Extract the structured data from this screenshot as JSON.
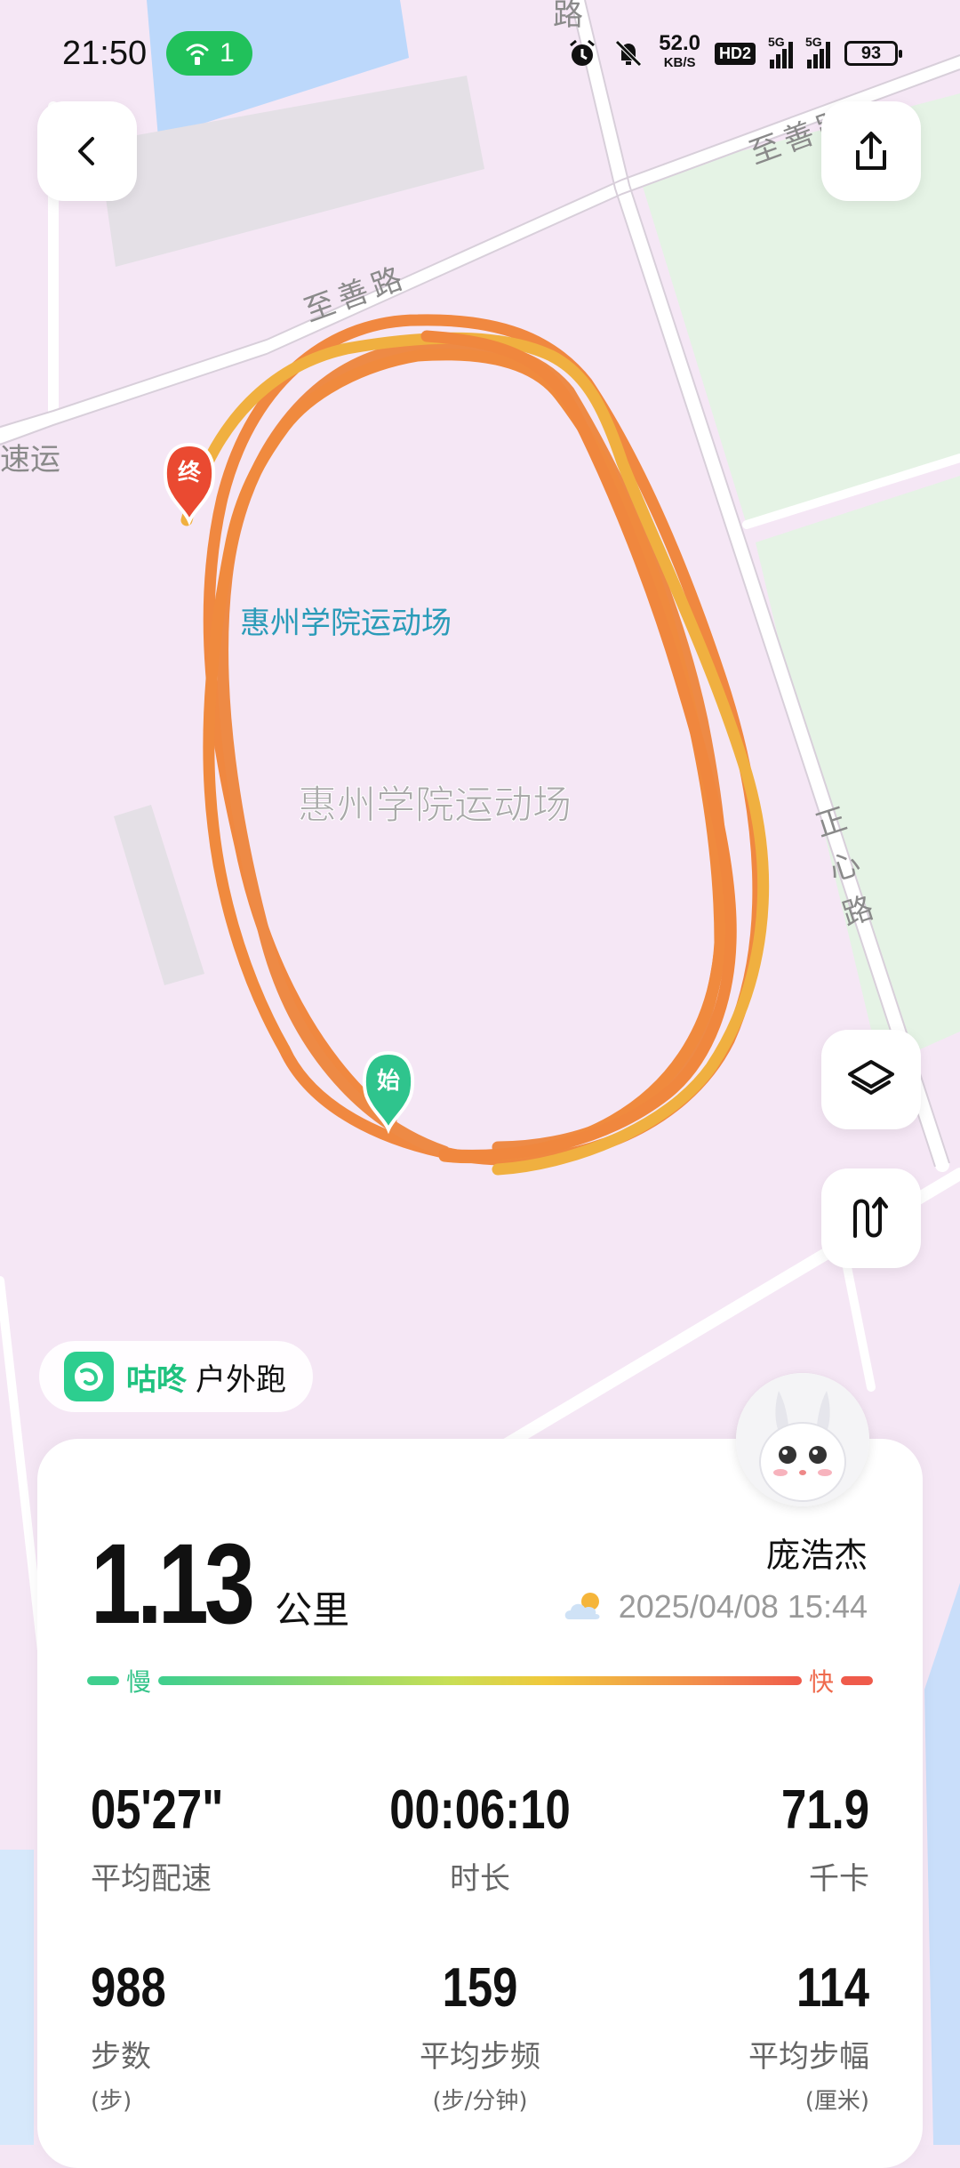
{
  "status_bar": {
    "time": "21:50",
    "hotspot_count": "1",
    "net_speed": "52.0",
    "net_speed_unit": "KB/S",
    "hd_badge": "HD2",
    "signal1_label": "5G",
    "signal2_label": "5G",
    "battery": "93"
  },
  "map": {
    "roads": {
      "zhishan_a": "至善路",
      "zhishan_b": "至善路",
      "zhengxin": "正心路",
      "lu_top": "路",
      "susuyun": "速运"
    },
    "venue_label_a": "惠州学院运动场",
    "venue_label_b": "惠州学院运动场",
    "start_marker": "始",
    "end_marker": "终"
  },
  "brand": {
    "name": "咕咚",
    "activity": "户外跑"
  },
  "summary": {
    "distance": "1.13",
    "distance_unit": "公里",
    "user_name": "庞浩杰",
    "datetime": "2025/04/08 15:44",
    "weather_icon": "partly-cloudy-icon",
    "pace_slow": "慢",
    "pace_fast": "快"
  },
  "stats": {
    "pace": {
      "value": "05'27\"",
      "label": "平均配速"
    },
    "duration": {
      "value": "00:06:10",
      "label": "时长"
    },
    "calories": {
      "value": "71.9",
      "label": "千卡"
    },
    "steps": {
      "value": "988",
      "label": "步数",
      "unit": "(步)"
    },
    "cadence": {
      "value": "159",
      "label": "平均步频",
      "unit": "(步/分钟)"
    },
    "stride": {
      "value": "114",
      "label": "平均步幅",
      "unit": "(厘米)"
    }
  },
  "colors": {
    "route_orange": "#f0863d",
    "route_yellow": "#f3b63c",
    "brand_green": "#1fc27f",
    "start_green": "#2fc48d",
    "end_red": "#ea4a31"
  }
}
